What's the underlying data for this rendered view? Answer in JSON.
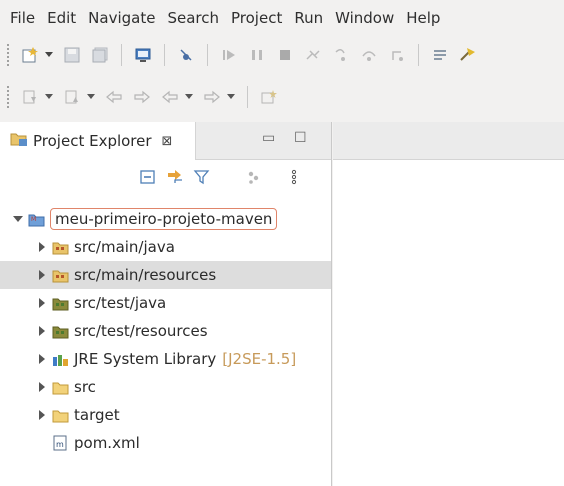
{
  "menu": [
    "File",
    "Edit",
    "Navigate",
    "Search",
    "Project",
    "Run",
    "Window",
    "Help"
  ],
  "view": {
    "title": "Project Explorer",
    "close_glyph": "⊠",
    "minimize_glyph": "▭",
    "maximize_glyph": "☐"
  },
  "tree": {
    "project": "meu-primeiro-projeto-maven",
    "items": [
      {
        "label": "src/main/java",
        "icon": "source-folder-icon"
      },
      {
        "label": "src/main/resources",
        "icon": "source-folder-icon",
        "selected": true
      },
      {
        "label": "src/test/java",
        "icon": "test-source-folder-icon"
      },
      {
        "label": "src/test/resources",
        "icon": "test-source-folder-icon"
      },
      {
        "label": "JRE System Library",
        "decoration": "[J2SE-1.5]",
        "icon": "library-icon"
      },
      {
        "label": "src",
        "icon": "folder-icon"
      },
      {
        "label": "target",
        "icon": "folder-icon"
      },
      {
        "label": "pom.xml",
        "icon": "maven-file-icon"
      }
    ]
  },
  "colors": {
    "selection": "#dddddd",
    "project_highlight": "#e0856a",
    "decoration": "#c79a5a"
  }
}
